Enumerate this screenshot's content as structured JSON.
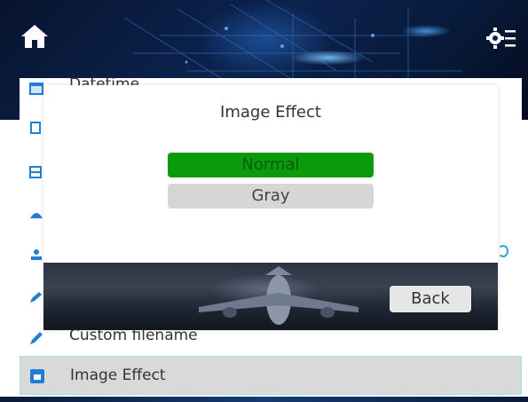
{
  "header": {
    "home_icon": "home-icon",
    "settings_icon": "settings-icon"
  },
  "list": {
    "items": [
      {
        "label": "Datetime",
        "icon": "calendar-icon"
      },
      {
        "label": "Custom filename",
        "icon": "pencil-icon"
      },
      {
        "label": "Image Effect",
        "icon": "image-icon",
        "selected": true
      }
    ]
  },
  "dialog": {
    "title": "Image Effect",
    "options": [
      {
        "label": "Normal",
        "selected": true
      },
      {
        "label": "Gray",
        "selected": false
      }
    ],
    "back_label": "Back"
  },
  "colors": {
    "selected_option": "#0b9a0b",
    "unselected_option": "#d6d6d6",
    "selected_row": "#d9d9d9",
    "icon_blue": "#1f7fd6"
  }
}
